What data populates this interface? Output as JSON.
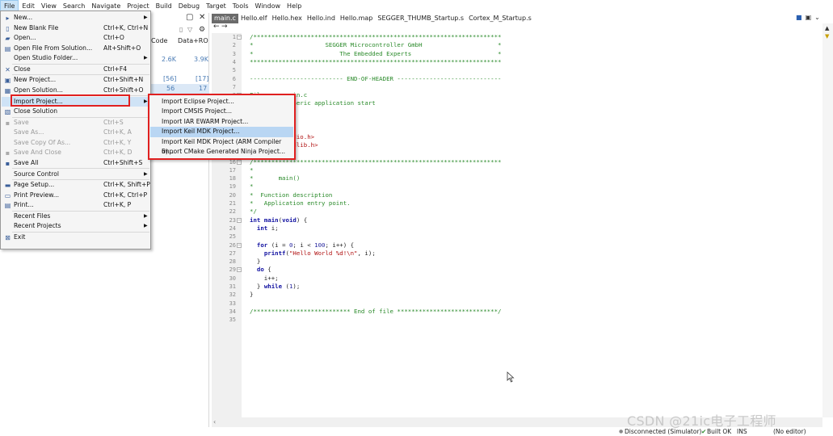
{
  "menubar": {
    "items": [
      "File",
      "Edit",
      "View",
      "Search",
      "Navigate",
      "Project",
      "Build",
      "Debug",
      "Target",
      "Tools",
      "Window",
      "Help"
    ]
  },
  "left_panel": {
    "col_code": "Code",
    "col_data": "Data+RO",
    "rows": [
      {
        "code": "2.6K",
        "data": "3.9K"
      },
      {
        "code": "[56]",
        "data": "[17]"
      },
      {
        "code": "56",
        "data": "17"
      }
    ]
  },
  "tabs": [
    "main.c",
    "Hello.elf",
    "Hello.hex",
    "Hello.ind",
    "Hello.map",
    "SEGGER_THUMB_Startup.s",
    "Cortex_M_Startup.s"
  ],
  "file_menu": {
    "items": [
      {
        "label": "New...",
        "shortcut": "",
        "icon": "new-file-icon",
        "glyph": "▸",
        "submenu": true
      },
      {
        "label": "New Blank File",
        "shortcut": "Ctrl+K, Ctrl+N",
        "icon": "blank-file-icon",
        "glyph": "▯"
      },
      {
        "label": "Open...",
        "shortcut": "Ctrl+O",
        "icon": "open-folder-icon",
        "glyph": "▰"
      },
      {
        "label": "Open File From Solution...",
        "shortcut": "Alt+Shift+O",
        "icon": "open-solution-file-icon",
        "glyph": "▤"
      },
      {
        "label": "Open Studio Folder...",
        "shortcut": "",
        "icon": "",
        "glyph": "",
        "submenu": true
      },
      {
        "label": "Close",
        "shortcut": "Ctrl+F4",
        "icon": "close-icon",
        "glyph": "✕"
      },
      {
        "label": "New Project...",
        "shortcut": "Ctrl+Shift+N",
        "icon": "new-project-icon",
        "glyph": "▣"
      },
      {
        "label": "Open Solution...",
        "shortcut": "Ctrl+Shift+O",
        "icon": "open-solution-icon",
        "glyph": "▦"
      },
      {
        "label": "Import Project...",
        "shortcut": "",
        "icon": "",
        "glyph": "",
        "submenu": true,
        "highlight": true
      },
      {
        "label": "Close Solution",
        "shortcut": "",
        "icon": "close-solution-icon",
        "glyph": "▧"
      },
      {
        "label": "Save",
        "shortcut": "Ctrl+S",
        "icon": "save-icon",
        "glyph": "▪",
        "disabled": true
      },
      {
        "label": "Save As...",
        "shortcut": "Ctrl+K, A",
        "icon": "",
        "glyph": "",
        "disabled": true
      },
      {
        "label": "Save Copy Of As...",
        "shortcut": "Ctrl+K, Y",
        "icon": "",
        "glyph": "",
        "disabled": true
      },
      {
        "label": "Save And Close",
        "shortcut": "Ctrl+K, D",
        "icon": "save-close-icon",
        "glyph": "▪",
        "disabled": true
      },
      {
        "label": "Save All",
        "shortcut": "Ctrl+Shift+S",
        "icon": "save-all-icon",
        "glyph": "▪"
      },
      {
        "label": "Source Control",
        "shortcut": "",
        "icon": "",
        "glyph": "",
        "submenu": true
      },
      {
        "label": "Page Setup...",
        "shortcut": "Ctrl+K, Shift+P",
        "icon": "page-setup-icon",
        "glyph": "▬"
      },
      {
        "label": "Print Preview...",
        "shortcut": "Ctrl+K, Ctrl+P",
        "icon": "print-preview-icon",
        "glyph": "▭"
      },
      {
        "label": "Print...",
        "shortcut": "Ctrl+K, P",
        "icon": "print-icon",
        "glyph": "▤"
      },
      {
        "label": "Recent Files",
        "shortcut": "",
        "icon": "",
        "glyph": "",
        "submenu": true
      },
      {
        "label": "Recent Projects",
        "shortcut": "",
        "icon": "",
        "glyph": "",
        "submenu": true
      },
      {
        "label": "Exit",
        "shortcut": "",
        "icon": "exit-icon",
        "glyph": "⊠"
      }
    ]
  },
  "import_menu": {
    "items": [
      {
        "label": "Import Eclipse Project..."
      },
      {
        "label": "Import CMSIS Project..."
      },
      {
        "label": "Import IAR EWARM Project..."
      },
      {
        "label": "Import Keil MDK Project...",
        "highlight": true
      },
      {
        "label": "Import Keil MDK Project (ARM Compiler 6)..."
      },
      {
        "label": "Import CMake Generated Ninja Project..."
      }
    ]
  },
  "code": {
    "lines": [
      {
        "n": "1",
        "fold": true,
        "segs": [
          [
            "cmt",
            "/*********************************************************************"
          ]
        ]
      },
      {
        "n": "2",
        "segs": [
          [
            "cmt",
            "*                    SEGGER Microcontroller GmbH                     *"
          ]
        ]
      },
      {
        "n": "3",
        "segs": [
          [
            "cmt",
            "*                        The Embedded Experts                        *"
          ]
        ]
      },
      {
        "n": "4",
        "segs": [
          [
            "cmt",
            "**********************************************************************"
          ]
        ]
      },
      {
        "n": "5",
        "segs": [
          [
            "cmt",
            ""
          ]
        ]
      },
      {
        "n": "6",
        "segs": [
          [
            "cmt",
            "-------------------------- END-OF-HEADER -----------------------------"
          ]
        ]
      },
      {
        "n": "7",
        "segs": [
          [
            "cmt",
            ""
          ]
        ]
      },
      {
        "n": "8",
        "fold": true,
        "segs": [
          [
            "cmt",
            "File    : main.c"
          ]
        ]
      },
      {
        "n": "9",
        "segs": [
          [
            "cmt",
            "Purpose : Generic application start"
          ]
        ]
      },
      {
        "n": "10",
        "segs": [
          [
            "cmt",
            ""
          ]
        ]
      },
      {
        "n": "11",
        "segs": [
          [
            "cmt",
            "*/"
          ]
        ]
      },
      {
        "n": "12",
        "segs": [
          [
            "plain",
            ""
          ]
        ]
      },
      {
        "n": "13",
        "segs": [
          [
            "str",
            "#include <stdio.h>"
          ]
        ]
      },
      {
        "n": "14",
        "segs": [
          [
            "str",
            "#include <stdlib.h>"
          ]
        ]
      },
      {
        "n": "15",
        "segs": [
          [
            "plain",
            ""
          ]
        ]
      },
      {
        "n": "16",
        "fold": true,
        "segs": [
          [
            "cmt",
            "/*********************************************************************"
          ]
        ]
      },
      {
        "n": "17",
        "segs": [
          [
            "cmt",
            "*"
          ]
        ]
      },
      {
        "n": "18",
        "segs": [
          [
            "cmt",
            "*       main()"
          ]
        ]
      },
      {
        "n": "19",
        "segs": [
          [
            "cmt",
            "*"
          ]
        ]
      },
      {
        "n": "20",
        "segs": [
          [
            "cmt",
            "*  Function description"
          ]
        ]
      },
      {
        "n": "21",
        "segs": [
          [
            "cmt",
            "*   Application entry point."
          ]
        ]
      },
      {
        "n": "22",
        "segs": [
          [
            "cmt",
            "*/"
          ]
        ]
      },
      {
        "n": "23",
        "fold": true,
        "segs": [
          [
            "kw",
            "int"
          ],
          [
            "plain",
            " "
          ],
          [
            "kw",
            "main"
          ],
          [
            "plain",
            "("
          ],
          [
            "kw",
            "void"
          ],
          [
            "plain",
            ") {"
          ]
        ]
      },
      {
        "n": "24",
        "segs": [
          [
            "plain",
            "  "
          ],
          [
            "kw",
            "int"
          ],
          [
            "plain",
            " i;"
          ]
        ]
      },
      {
        "n": "25",
        "segs": [
          [
            "plain",
            ""
          ]
        ]
      },
      {
        "n": "26",
        "fold": true,
        "segs": [
          [
            "plain",
            "  "
          ],
          [
            "kw",
            "for"
          ],
          [
            "plain",
            " (i = "
          ],
          [
            "num",
            "0"
          ],
          [
            "plain",
            "; i < "
          ],
          [
            "num",
            "100"
          ],
          [
            "plain",
            "; i++) {"
          ]
        ]
      },
      {
        "n": "27",
        "segs": [
          [
            "plain",
            "    "
          ],
          [
            "kw",
            "printf"
          ],
          [
            "plain",
            "("
          ],
          [
            "str",
            "\"Hello World %d!\\n\""
          ],
          [
            "plain",
            ", i);"
          ]
        ]
      },
      {
        "n": "28",
        "segs": [
          [
            "plain",
            "  }"
          ]
        ]
      },
      {
        "n": "29",
        "fold": true,
        "segs": [
          [
            "plain",
            "  "
          ],
          [
            "kw",
            "do"
          ],
          [
            "plain",
            " {"
          ]
        ]
      },
      {
        "n": "30",
        "segs": [
          [
            "plain",
            "    i++;"
          ]
        ]
      },
      {
        "n": "31",
        "segs": [
          [
            "plain",
            "  } "
          ],
          [
            "kw",
            "while"
          ],
          [
            "plain",
            " ("
          ],
          [
            "num",
            "1"
          ],
          [
            "plain",
            ");"
          ]
        ]
      },
      {
        "n": "32",
        "segs": [
          [
            "plain",
            "}"
          ]
        ]
      },
      {
        "n": "33",
        "segs": [
          [
            "plain",
            ""
          ]
        ]
      },
      {
        "n": "34",
        "segs": [
          [
            "cmt",
            "/*************************** End of file ****************************/"
          ]
        ]
      },
      {
        "n": "35",
        "segs": [
          [
            "plain",
            ""
          ]
        ]
      }
    ]
  },
  "status": {
    "connection": "Disconnected (Simulator)",
    "build": "Built OK",
    "mode": "INS",
    "editor": "(No editor)"
  },
  "watermark": "CSDN @21ic电子工程师"
}
